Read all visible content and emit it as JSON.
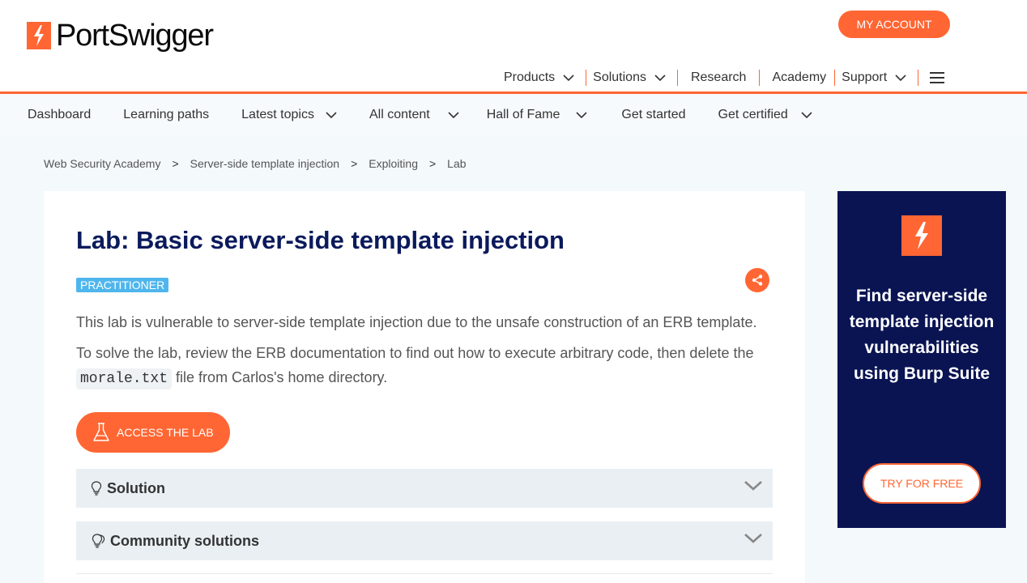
{
  "brand": {
    "name": "PortSwigger",
    "accent": "#ff6633",
    "navy": "#0a1453"
  },
  "header": {
    "account_label": "MY ACCOUNT",
    "nav": [
      {
        "label": "Products",
        "has_dropdown": true
      },
      {
        "label": "Solutions",
        "has_dropdown": true
      },
      {
        "label": "Research",
        "has_dropdown": false
      },
      {
        "label": "Academy",
        "has_dropdown": false
      },
      {
        "label": "Support",
        "has_dropdown": true
      }
    ],
    "menu_icon": "hamburger-icon"
  },
  "subnav": [
    {
      "label": "Dashboard",
      "has_dropdown": false
    },
    {
      "label": "Learning paths",
      "has_dropdown": false
    },
    {
      "label": "Latest topics",
      "has_dropdown": true
    },
    {
      "label": "All content",
      "has_dropdown": true
    },
    {
      "label": "Hall of Fame",
      "has_dropdown": true
    },
    {
      "label": "Get started",
      "has_dropdown": false
    },
    {
      "label": "Get certified",
      "has_dropdown": true
    }
  ],
  "breadcrumb": [
    "Web Security Academy",
    "Server-side template injection",
    "Exploiting",
    "Lab"
  ],
  "breadcrumb_sep": ">",
  "lab": {
    "title": "Lab: Basic server-side template injection",
    "level": "PRACTITIONER",
    "description": "This lab is vulnerable to server-side template injection due to the unsafe construction of an ERB template.",
    "task_before": "To solve the lab, review the ERB documentation to find out how to execute arbitrary code, then delete the",
    "task_code": "morale.txt",
    "task_after": "file from Carlos's home directory.",
    "access_label": "ACCESS THE LAB",
    "sections": [
      {
        "label": "Solution",
        "icon": "lightbulb-icon"
      },
      {
        "label": "Community solutions",
        "icon": "lightbulbs-icon"
      }
    ]
  },
  "ad": {
    "text": "Find server-side template injection vulnerabilities using Burp Suite",
    "cta": "TRY FOR FREE"
  }
}
